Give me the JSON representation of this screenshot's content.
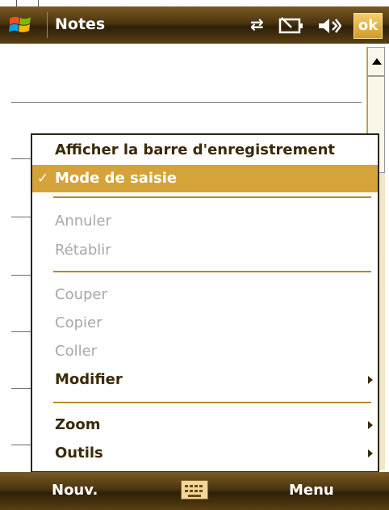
{
  "title_bar": {
    "app_title": "Notes",
    "status_icons": [
      "connectivity-icon",
      "battery-icon",
      "volume-icon"
    ],
    "ok_label": "ok"
  },
  "menu": {
    "items": [
      {
        "label": "Afficher la barre d'enregistrement",
        "state": "enabled"
      },
      {
        "label": "Mode de saisie",
        "state": "selected",
        "checked": true
      },
      {
        "label": "Annuler",
        "state": "disabled"
      },
      {
        "label": "Rétablir",
        "state": "disabled"
      },
      {
        "label": "Couper",
        "state": "disabled"
      },
      {
        "label": "Copier",
        "state": "disabled"
      },
      {
        "label": "Coller",
        "state": "disabled"
      },
      {
        "label": "Modifier",
        "state": "enabled",
        "submenu": true
      },
      {
        "label": "Zoom",
        "state": "enabled",
        "submenu": true
      },
      {
        "label": "Outils",
        "state": "enabled",
        "submenu": true
      }
    ],
    "check_glyph": "✓"
  },
  "softkeys": {
    "left": "Nouv.",
    "right": "Menu",
    "center_icon": "keyboard-icon"
  },
  "colors": {
    "bar_dark": "#2e1f08",
    "accent": "#d4a339",
    "ok_button": "#e0aa3a"
  }
}
